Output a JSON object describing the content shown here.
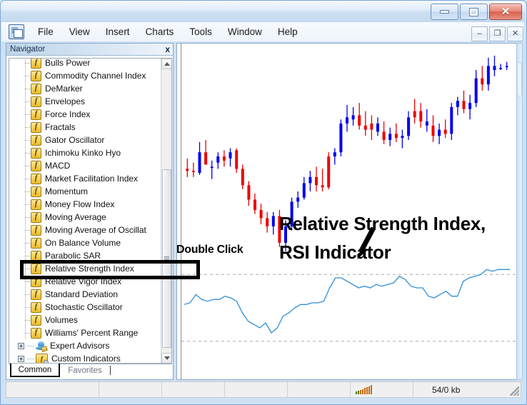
{
  "window": {
    "titlebar_buttons": [
      {
        "name": "minimize",
        "glyph": "minimize-icon"
      },
      {
        "name": "maximize",
        "glyph": "maximize-icon"
      },
      {
        "name": "close",
        "glyph": "close-icon",
        "label": "✕"
      }
    ],
    "mdi_buttons": [
      {
        "name": "mdi-minimize",
        "label": "–"
      },
      {
        "name": "mdi-restore",
        "label": "❐"
      },
      {
        "name": "mdi-close",
        "label": "✕"
      }
    ]
  },
  "menu": {
    "items": [
      "File",
      "View",
      "Insert",
      "Charts",
      "Tools",
      "Window",
      "Help"
    ]
  },
  "navigator": {
    "title": "Navigator",
    "close_label": "x",
    "tree": [
      {
        "label": "Bulls Power",
        "icon": "function-icon",
        "level": 2,
        "highlighted": false
      },
      {
        "label": "Commodity Channel Index",
        "icon": "function-icon",
        "level": 2,
        "highlighted": false
      },
      {
        "label": "DeMarker",
        "icon": "function-icon",
        "level": 2,
        "highlighted": false
      },
      {
        "label": "Envelopes",
        "icon": "function-icon",
        "level": 2,
        "highlighted": false
      },
      {
        "label": "Force Index",
        "icon": "function-icon",
        "level": 2,
        "highlighted": false
      },
      {
        "label": "Fractals",
        "icon": "function-icon",
        "level": 2,
        "highlighted": false
      },
      {
        "label": "Gator Oscillator",
        "icon": "function-icon",
        "level": 2,
        "highlighted": false
      },
      {
        "label": "Ichimoku Kinko Hyo",
        "icon": "function-icon",
        "level": 2,
        "highlighted": false
      },
      {
        "label": "MACD",
        "icon": "function-icon",
        "level": 2,
        "highlighted": false
      },
      {
        "label": "Market Facilitation Index",
        "icon": "function-icon",
        "level": 2,
        "highlighted": false
      },
      {
        "label": "Momentum",
        "icon": "function-icon",
        "level": 2,
        "highlighted": false
      },
      {
        "label": "Money Flow Index",
        "icon": "function-icon",
        "level": 2,
        "highlighted": false
      },
      {
        "label": "Moving Average",
        "icon": "function-icon",
        "level": 2,
        "highlighted": false
      },
      {
        "label": "Moving Average of Oscillat",
        "icon": "function-icon",
        "level": 2,
        "highlighted": false
      },
      {
        "label": "On Balance Volume",
        "icon": "function-icon",
        "level": 2,
        "highlighted": false
      },
      {
        "label": "Parabolic SAR",
        "icon": "function-icon",
        "level": 2,
        "highlighted": false
      },
      {
        "label": "Relative Strength Index",
        "icon": "function-icon",
        "level": 2,
        "highlighted": true
      },
      {
        "label": "Relative Vigor Index",
        "icon": "function-icon",
        "level": 2,
        "highlighted": false
      },
      {
        "label": "Standard Deviation",
        "icon": "function-icon",
        "level": 2,
        "highlighted": false
      },
      {
        "label": "Stochastic Oscillator",
        "icon": "function-icon",
        "level": 2,
        "highlighted": false
      },
      {
        "label": "Volumes",
        "icon": "function-icon",
        "level": 2,
        "highlighted": false
      },
      {
        "label": "Williams' Percent Range",
        "icon": "function-icon",
        "level": 2,
        "highlighted": false
      }
    ],
    "roots": [
      {
        "label": "Expert Advisors",
        "icon": "expert-advisor-icon",
        "expander": "+"
      },
      {
        "label": "Custom Indicators",
        "icon": "custom-indicator-icon",
        "expander": "+"
      }
    ],
    "tabs": [
      {
        "label": "Common",
        "active": true
      },
      {
        "label": "Favorites",
        "active": false
      }
    ]
  },
  "annotations": {
    "title_line1": "Relative Strength Index,",
    "title_line2": "RSI Indicator",
    "double_click": "Double Click"
  },
  "statusbar": {
    "traffic_label": "54/0 kb",
    "signal_icon": "signal-strength-icon"
  },
  "colors": {
    "bull_candle": "#0000ee",
    "bear_candle": "#ee0000",
    "rsi_line": "#2f8fd8",
    "level_line": "#aaaaaa",
    "accent": "#7ba7d7"
  },
  "chart_data": {
    "type": "line",
    "title": "",
    "xlabel": "",
    "ylabel": "",
    "grid": false,
    "legend": "none",
    "panels": [
      {
        "name": "price-candlestick-panel",
        "type": "candlestick",
        "ylim": [
          0,
          100
        ],
        "candles": [
          {
            "o": 44,
            "h": 49,
            "l": 40,
            "c": 43,
            "dir": "down"
          },
          {
            "o": 43,
            "h": 47,
            "l": 40,
            "c": 43,
            "dir": "down"
          },
          {
            "o": 42,
            "h": 57,
            "l": 41,
            "c": 52,
            "dir": "up"
          },
          {
            "o": 52,
            "h": 58,
            "l": 47,
            "c": 46,
            "dir": "down"
          },
          {
            "o": 45,
            "h": 48,
            "l": 39,
            "c": 45,
            "dir": "up"
          },
          {
            "o": 47,
            "h": 52,
            "l": 44,
            "c": 50,
            "dir": "up"
          },
          {
            "o": 50,
            "h": 53,
            "l": 45,
            "c": 48,
            "dir": "down"
          },
          {
            "o": 49,
            "h": 54,
            "l": 45,
            "c": 52,
            "dir": "up"
          },
          {
            "o": 53,
            "h": 54,
            "l": 42,
            "c": 44,
            "dir": "down"
          },
          {
            "o": 44,
            "h": 46,
            "l": 34,
            "c": 36,
            "dir": "down"
          },
          {
            "o": 36,
            "h": 38,
            "l": 26,
            "c": 29,
            "dir": "down"
          },
          {
            "o": 29,
            "h": 32,
            "l": 22,
            "c": 24,
            "dir": "down"
          },
          {
            "o": 24,
            "h": 27,
            "l": 17,
            "c": 20,
            "dir": "down"
          },
          {
            "o": 20,
            "h": 23,
            "l": 13,
            "c": 16,
            "dir": "down"
          },
          {
            "o": 16,
            "h": 23,
            "l": 12,
            "c": 21,
            "dir": "up"
          },
          {
            "o": 21,
            "h": 24,
            "l": 6,
            "c": 8,
            "dir": "down"
          },
          {
            "o": 8,
            "h": 19,
            "l": 4,
            "c": 16,
            "dir": "up"
          },
          {
            "o": 16,
            "h": 30,
            "l": 14,
            "c": 28,
            "dir": "up"
          },
          {
            "o": 28,
            "h": 33,
            "l": 25,
            "c": 30,
            "dir": "up"
          },
          {
            "o": 30,
            "h": 40,
            "l": 29,
            "c": 37,
            "dir": "up"
          },
          {
            "o": 37,
            "h": 43,
            "l": 33,
            "c": 40,
            "dir": "up"
          },
          {
            "o": 40,
            "h": 45,
            "l": 33,
            "c": 36,
            "dir": "down"
          },
          {
            "o": 36,
            "h": 44,
            "l": 33,
            "c": 35,
            "dir": "down"
          },
          {
            "o": 35,
            "h": 52,
            "l": 34,
            "c": 50,
            "dir": "down"
          },
          {
            "o": 50,
            "h": 54,
            "l": 46,
            "c": 52,
            "dir": "up"
          },
          {
            "o": 52,
            "h": 68,
            "l": 50,
            "c": 66,
            "dir": "up"
          },
          {
            "o": 66,
            "h": 75,
            "l": 62,
            "c": 69,
            "dir": "up"
          },
          {
            "o": 68,
            "h": 74,
            "l": 65,
            "c": 70,
            "dir": "up"
          },
          {
            "o": 70,
            "h": 76,
            "l": 63,
            "c": 65,
            "dir": "down"
          },
          {
            "o": 65,
            "h": 72,
            "l": 60,
            "c": 63,
            "dir": "down"
          },
          {
            "o": 63,
            "h": 70,
            "l": 58,
            "c": 66,
            "dir": "down"
          },
          {
            "o": 66,
            "h": 69,
            "l": 60,
            "c": 62,
            "dir": "up"
          },
          {
            "o": 62,
            "h": 67,
            "l": 56,
            "c": 58,
            "dir": "down"
          },
          {
            "o": 58,
            "h": 64,
            "l": 55,
            "c": 61,
            "dir": "up"
          },
          {
            "o": 61,
            "h": 66,
            "l": 57,
            "c": 59,
            "dir": "down"
          },
          {
            "o": 59,
            "h": 63,
            "l": 54,
            "c": 60,
            "dir": "up"
          },
          {
            "o": 60,
            "h": 72,
            "l": 58,
            "c": 69,
            "dir": "up"
          },
          {
            "o": 69,
            "h": 78,
            "l": 66,
            "c": 72,
            "dir": "down"
          },
          {
            "o": 72,
            "h": 76,
            "l": 64,
            "c": 67,
            "dir": "down"
          },
          {
            "o": 67,
            "h": 73,
            "l": 62,
            "c": 65,
            "dir": "up"
          },
          {
            "o": 65,
            "h": 70,
            "l": 57,
            "c": 60,
            "dir": "down"
          },
          {
            "o": 60,
            "h": 66,
            "l": 56,
            "c": 63,
            "dir": "up"
          },
          {
            "o": 63,
            "h": 68,
            "l": 59,
            "c": 61,
            "dir": "down"
          },
          {
            "o": 61,
            "h": 76,
            "l": 58,
            "c": 74,
            "dir": "up"
          },
          {
            "o": 74,
            "h": 79,
            "l": 70,
            "c": 77,
            "dir": "up"
          },
          {
            "o": 77,
            "h": 82,
            "l": 71,
            "c": 73,
            "dir": "down"
          },
          {
            "o": 73,
            "h": 80,
            "l": 68,
            "c": 76,
            "dir": "up"
          },
          {
            "o": 76,
            "h": 92,
            "l": 74,
            "c": 88,
            "dir": "up"
          },
          {
            "o": 88,
            "h": 94,
            "l": 82,
            "c": 85,
            "dir": "down"
          },
          {
            "o": 85,
            "h": 98,
            "l": 82,
            "c": 94,
            "dir": "up"
          },
          {
            "o": 94,
            "h": 99,
            "l": 89,
            "c": 92,
            "dir": "up"
          },
          {
            "o": 93,
            "h": 95,
            "l": 92,
            "c": 93,
            "dir": "up"
          },
          {
            "o": 94,
            "h": 96,
            "l": 92,
            "c": 94,
            "dir": "up"
          }
        ]
      },
      {
        "name": "rsi-indicator-panel",
        "type": "line",
        "series_name": "Relative Strength Index",
        "ylim": [
          0,
          100
        ],
        "levels": [
          70,
          30
        ],
        "values": [
          52,
          53,
          58,
          55,
          54,
          55,
          55,
          57,
          56,
          54,
          47,
          42,
          40,
          38,
          41,
          35,
          38,
          45,
          47,
          50,
          52,
          52,
          53,
          53,
          54,
          62,
          68,
          68,
          66,
          64,
          62,
          63,
          62,
          64,
          63,
          64,
          65,
          69,
          67,
          63,
          62,
          62,
          57,
          56,
          58,
          60,
          57,
          57,
          66,
          68,
          69,
          70,
          73,
          72,
          73,
          73,
          73
        ]
      }
    ]
  }
}
